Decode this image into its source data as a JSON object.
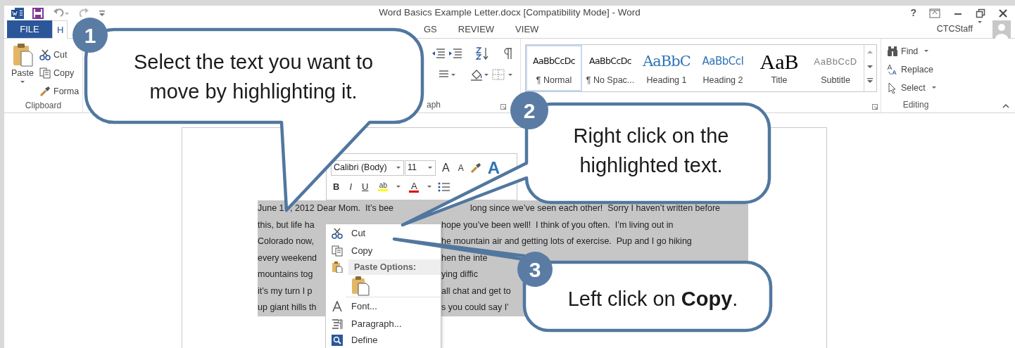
{
  "window": {
    "title": "Word Basics Example Letter.docx [Compatibility Mode] - Word",
    "help": "?",
    "user": "CTCStaff"
  },
  "tabs": [
    {
      "label": "FILE",
      "kind": "file",
      "selected": false
    },
    {
      "label": "H",
      "kind": "tab",
      "selected": true
    },
    {
      "label": "GS",
      "kind": "tab",
      "selected": false
    },
    {
      "label": "REVIEW",
      "kind": "tab",
      "selected": false
    },
    {
      "label": "VIEW",
      "kind": "tab",
      "selected": false
    }
  ],
  "clipboard": {
    "paste": "Paste",
    "commands": [
      "Cut",
      "Copy",
      "Forma"
    ],
    "label": "Clipboard"
  },
  "paragraph": {
    "label": "aph"
  },
  "styles": [
    {
      "preview": "AaBbCcDc",
      "name": "¶ Normal",
      "kind": "body",
      "selected": true
    },
    {
      "preview": "AaBbCcDc",
      "name": "¶ No Spac...",
      "kind": "body",
      "selected": false
    },
    {
      "preview": "AaBbC",
      "name": "Heading 1",
      "kind": "heading1",
      "selected": false
    },
    {
      "preview": "AaBbCcI",
      "name": "Heading 2",
      "kind": "heading2",
      "selected": false
    },
    {
      "preview": "AaB",
      "name": "Title",
      "kind": "title",
      "selected": false
    },
    {
      "preview": "AaBbCcD",
      "name": "Subtitle",
      "kind": "subtitle",
      "selected": false
    }
  ],
  "editing": {
    "commands": [
      "Find",
      "Replace",
      "Select"
    ],
    "label": "Editing"
  },
  "mini_toolbar": {
    "font": "Calibri (Body)",
    "size": "11",
    "grow": "A",
    "shrink": "A",
    "styles": "A",
    "formats": [
      "B",
      "I",
      "U"
    ],
    "highlight": "ab",
    "font_color": "A"
  },
  "document": {
    "lines": [
      {
        "pieces": [
          "June 1",
          ", 2012 Dear Mom.  It’s bee",
          "long since we’ve seen each other!  Sorry I haven’t written before"
        ]
      },
      {
        "left": "this, but life ha",
        "right": "hope you’ve been well!  I think of you often.  I’m living out in"
      },
      {
        "left": "Colorado now,",
        "right": "he mountain air and getting lots of exercise.  Pup and I go hiking"
      },
      {
        "left": "every weekend",
        "right": "hen the inte"
      },
      {
        "left": "mountains tog",
        "right": "ying diffic"
      },
      {
        "left": "it’s my turn I p",
        "right": "all chat and get to"
      },
      {
        "left": "up giant hills th",
        "right": "s you could say I’"
      }
    ]
  },
  "context_menu": {
    "items": [
      {
        "kind": "command",
        "label": "Cut"
      },
      {
        "kind": "command",
        "label": "Copy"
      },
      {
        "kind": "header",
        "label": "Paste Options:"
      },
      {
        "kind": "paste"
      },
      {
        "kind": "command",
        "label": "Font..."
      },
      {
        "kind": "command",
        "label": "Paragraph..."
      },
      {
        "kind": "command",
        "label": "Define"
      }
    ]
  },
  "callouts": [
    {
      "number": "1",
      "text": "Select the text you want to move by highlighting it."
    },
    {
      "number": "2",
      "text": "Right click on the highlighted text."
    },
    {
      "number": "3",
      "text": "Left click on **Copy**."
    }
  ]
}
